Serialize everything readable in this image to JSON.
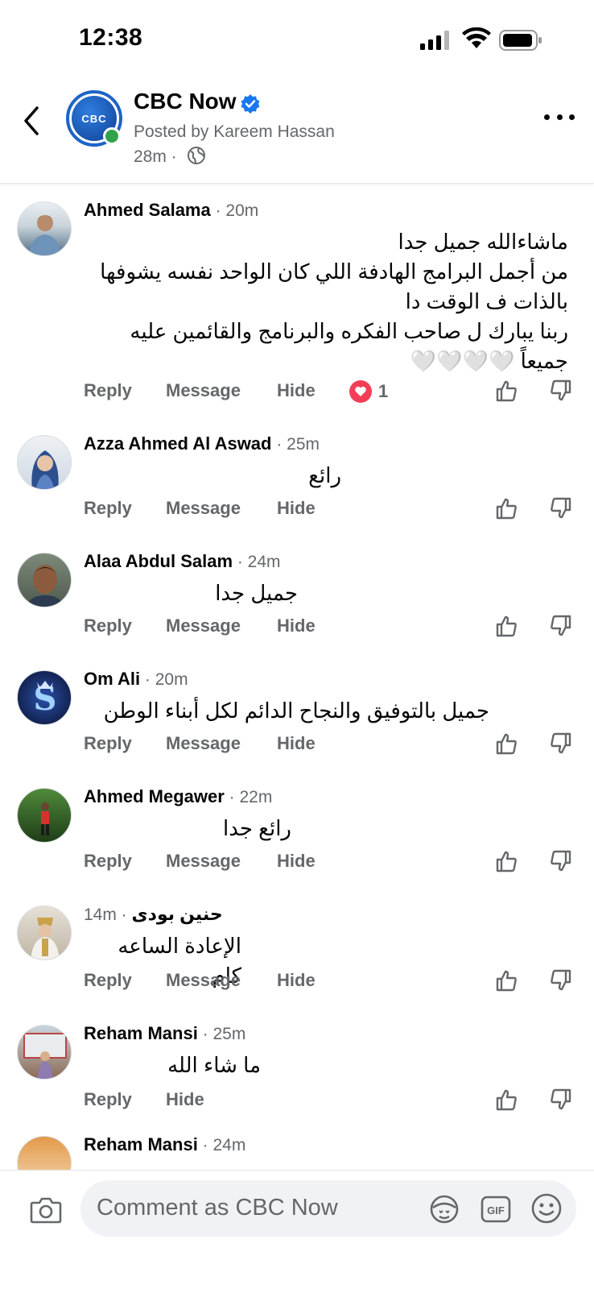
{
  "status": {
    "time": "12:38"
  },
  "header": {
    "page_name": "CBC Now",
    "avatar_text": "CBC",
    "posted_by": "Posted by Kareem Hassan",
    "post_time": "28m ·"
  },
  "actions": {
    "reply": "Reply",
    "message": "Message",
    "hide": "Hide"
  },
  "comments": [
    {
      "author": "Ahmed Salama",
      "time": " · 20m",
      "lines": [
        "ماشاءالله جميل جدا",
        "من أجمل البرامج الهادفة اللي كان الواحد نفسه يشوفها",
        "بالذات ف الوقت دا",
        "ربنا يبارك ل صاحب الفكره والبرنامج والقائمين عليه",
        "جميعاً 🤍🤍🤍🤍"
      ],
      "reaction_count": "1"
    },
    {
      "author": "Azza Ahmed Al Aswad",
      "time": " · 25m",
      "text": "رائع"
    },
    {
      "author": "Alaa Abdul Salam",
      "time": " · 24m",
      "text": "جميل جدا"
    },
    {
      "author": "Om Ali",
      "time": " · 20m",
      "text": "جميل بالتوفيق والنجاح الدائم لكل أبناء الوطن"
    },
    {
      "author": "Ahmed Megawer",
      "time": " · 22m",
      "text": "رائع جدا"
    },
    {
      "author": "حنين  بودى",
      "time": "14m · ",
      "text": "الإعادة الساعه كام"
    },
    {
      "author": "Reham Mansi",
      "time": " · 25m",
      "text": "ما شاء الله"
    },
    {
      "author": "Reham Mansi",
      "time": " · 24m"
    }
  ],
  "composer": {
    "placeholder": "Comment as CBC Now"
  }
}
